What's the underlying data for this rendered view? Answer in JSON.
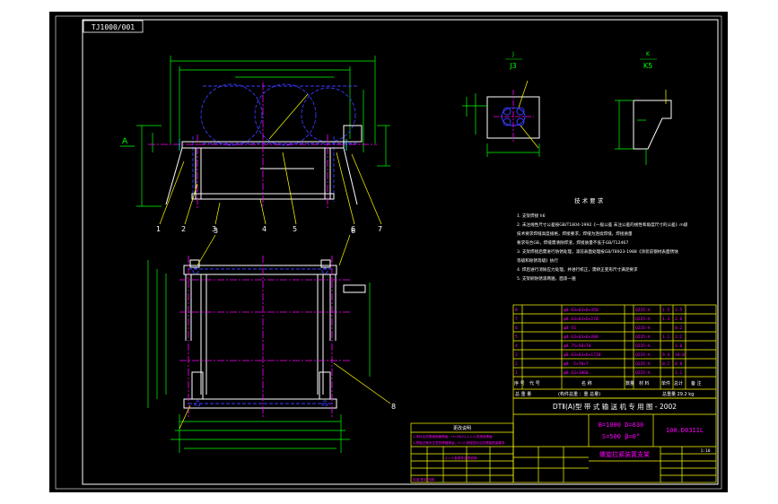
{
  "colors": {
    "background": "#000000",
    "frame": "#ffffff",
    "outline": "#ffffff",
    "dimension": "#00ff00",
    "hidden": "#4040ff",
    "center": "#ff00ff",
    "leader": "#ffff00",
    "table_line": "#ffff00",
    "table_text": "#ff00ff",
    "note_text": "#ffffff",
    "cyan": "#00ffff",
    "page_border": "#d8d8d8"
  },
  "drawing_number_box": "TJ1000/001",
  "section_labels": {
    "j": {
      "letter": "J",
      "title": "J3"
    },
    "k": {
      "letter": "K",
      "title": "K5"
    }
  },
  "view_marker": "A",
  "balloons_top": [
    "1",
    "2",
    "3",
    "4",
    "5",
    "6",
    "7"
  ],
  "tech_notes": {
    "title": "技 术 要 求",
    "lines": [
      "1. 支架焊接  h6",
      "2. 未注线性尺寸公差按GB/T1804-1992《一般公差 未注公差的线性和角度尺寸的公差》m级",
      "   技术要求焊缝高度规格，焊接要求，焊缝为连续焊缝，焊接质量",
      "   要求符合GB，焊缝需清除焊渣，焊接质量不低于GB/T12467",
      "3. 支架焊接后需进行防锈处理，漆前表面处理按GB/T8923-1988《涂装前钢材表面锈蚀",
      "   等级和除锈等级》执行",
      "4. 焊后进行消除应力处理，并进行校正，需矫正变形尺寸满足要求",
      "5. 支架刷防锈漆两遍，面漆一遍"
    ]
  },
  "bom_rows": [
    {
      "no": "8",
      "code": "",
      "name": "φ8 63×63×6×350",
      "qty": "",
      "mat": "Q235-A",
      "w1": "1.5",
      "w2": "1.5"
    },
    {
      "no": "7",
      "code": "",
      "name": "φ8 63×63×6×270",
      "qty": "",
      "mat": "Q235-A",
      "w1": "1.3",
      "w2": "2.6"
    },
    {
      "no": "6",
      "code": "",
      "name": "φ8  55",
      "qty": "",
      "mat": "Q235-A",
      "w1": "",
      "w2": "0.2"
    },
    {
      "no": "5",
      "code": "",
      "name": "φ8 63×63×6×200",
      "qty": "",
      "mat": "Q235-A",
      "w1": "1.1",
      "w2": "2.2"
    },
    {
      "no": "4",
      "code": "",
      "name": "φ8  75×50×70",
      "qty": "",
      "mat": "Q235-A",
      "w1": "",
      "w2": "1.0"
    },
    {
      "no": "3",
      "code": "",
      "name": "φ8 63×63×6×1730",
      "qty": "",
      "mat": "Q235-A",
      "w1": "9.4",
      "w2": "18.8"
    },
    {
      "no": "2",
      "code": "",
      "name": "φ8 -5×70×7",
      "qty": "",
      "mat": "Q235-A",
      "w1": "0.2",
      "w2": "0.8"
    },
    {
      "no": "1",
      "code": "",
      "name": "φ8 63×1060",
      "qty": "",
      "mat": "Q235-A",
      "w1": "",
      "w2": "1.1"
    }
  ],
  "bom_header": [
    "序 号",
    "代 号",
    "名 称",
    "数量",
    "材 料",
    "单件",
    "总计",
    "备 注"
  ],
  "bom_total": {
    "label": "总  重  量",
    "value": "(构件总重 ：重 总量)",
    "total": "总重量  29.2  kg"
  },
  "title_block": {
    "main_title": "DTⅡ(A)型  带 式 输 送 机 专 用 图 - 2002",
    "params_1": "B=1000  D=630",
    "params_2": "S=500  β=0°",
    "drawing_no": "100.D0311L",
    "part_name": "螺旋拉紧装置支架",
    "scale": "1:10"
  },
  "rev_table_title": "更改说明",
  "rev_lines": [
    "2.未标注的角钢规格等级：H=2B(H)-1-2.4 的规范等级",
    "3.焊接过程中注意的焊缝等级，H=2 按规范标注的焊缝质量要求",
    "4.1.3 各零件涂漆说明",
    "标准  签字  日期"
  ]
}
